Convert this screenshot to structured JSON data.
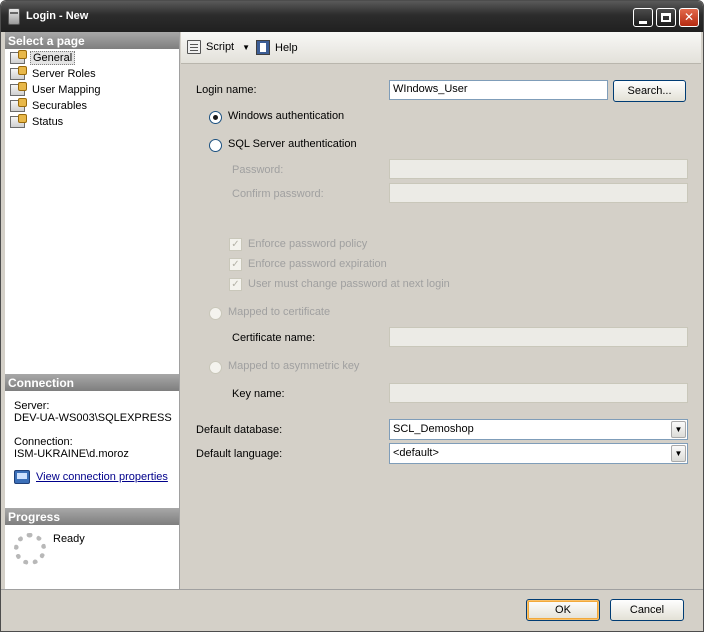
{
  "window": {
    "title": "Login - New"
  },
  "left_panel": {
    "select_header": "Select a page",
    "pages": [
      {
        "label": "General",
        "selected": true
      },
      {
        "label": "Server Roles"
      },
      {
        "label": "User Mapping"
      },
      {
        "label": "Securables"
      },
      {
        "label": "Status"
      }
    ],
    "connection_header": "Connection",
    "server_label": "Server:",
    "server_value": "DEV-UA-WS003\\SQLEXPRESS",
    "connection_label": "Connection:",
    "connection_value": "ISM-UKRAINE\\d.moroz",
    "view_link": "View connection properties",
    "progress_header": "Progress",
    "progress_status": "Ready"
  },
  "toolbar": {
    "script_label": "Script",
    "help_label": "Help"
  },
  "form": {
    "login_name_label": "Login name:",
    "login_name_value": "WIndows_User",
    "search_button": "Search...",
    "windows_auth_label": "Windows authentication",
    "sql_auth_label": "SQL Server authentication",
    "password_label": "Password:",
    "confirm_password_label": "Confirm password:",
    "enforce_policy_label": "Enforce password policy",
    "enforce_expiration_label": "Enforce password expiration",
    "must_change_label": "User must change password at next login",
    "mapped_cert_label": "Mapped to certificate",
    "cert_name_label": "Certificate name:",
    "mapped_key_label": "Mapped to asymmetric key",
    "key_name_label": "Key name:",
    "default_db_label": "Default database:",
    "default_db_value": "SCL_Demoshop",
    "default_lang_label": "Default language:",
    "default_lang_value": "<default>"
  },
  "buttons": {
    "ok": "OK",
    "cancel": "Cancel"
  }
}
